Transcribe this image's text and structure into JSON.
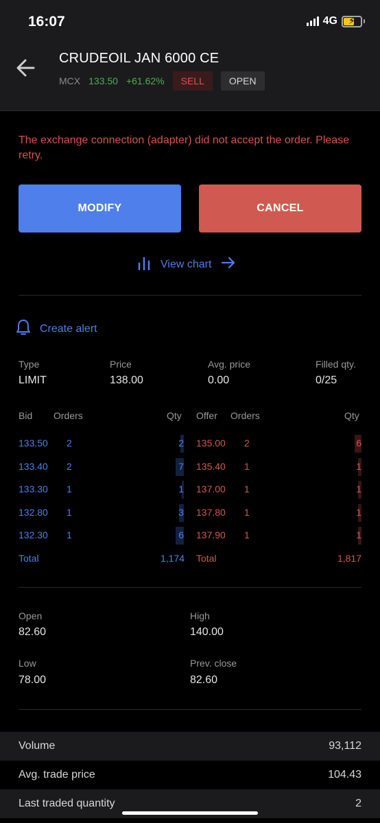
{
  "status_bar": {
    "time": "16:07",
    "network": "4G"
  },
  "header": {
    "title": "CRUDEOIL JAN 6000 CE",
    "exchange": "MCX",
    "ltp": "133.50",
    "change": "+61.62%",
    "side_badge": "SELL",
    "status_badge": "OPEN"
  },
  "error": {
    "message": "The exchange connection (adapter) did not accept the order. Please retry."
  },
  "actions": {
    "modify_label": "MODIFY",
    "cancel_label": "CANCEL",
    "view_chart_label": "View chart",
    "create_alert_label": "Create alert"
  },
  "order_info": {
    "type_label": "Type",
    "type_value": "LIMIT",
    "price_label": "Price",
    "price_value": "138.00",
    "avg_price_label": "Avg. price",
    "avg_price_value": "0.00",
    "filled_label": "Filled qty.",
    "filled_value": "0/25"
  },
  "depth": {
    "headers": {
      "bid": "Bid",
      "orders": "Orders",
      "qty": "Qty",
      "offer": "Offer"
    },
    "bids": [
      {
        "price": "133.50",
        "orders": "2",
        "qty": "2",
        "fill": 0.02
      },
      {
        "price": "133.40",
        "orders": "2",
        "qty": "7",
        "fill": 0.05
      },
      {
        "price": "133.30",
        "orders": "1",
        "qty": "1",
        "fill": 0.01
      },
      {
        "price": "132.80",
        "orders": "1",
        "qty": "3",
        "fill": 0.03
      },
      {
        "price": "132.30",
        "orders": "1",
        "qty": "6",
        "fill": 0.05
      }
    ],
    "asks": [
      {
        "price": "135.00",
        "orders": "2",
        "qty": "6",
        "fill": 0.04
      },
      {
        "price": "135.40",
        "orders": "1",
        "qty": "1",
        "fill": 0.02
      },
      {
        "price": "137.00",
        "orders": "1",
        "qty": "1",
        "fill": 0.02
      },
      {
        "price": "137.80",
        "orders": "1",
        "qty": "1",
        "fill": 0.02
      },
      {
        "price": "137.90",
        "orders": "1",
        "qty": "1",
        "fill": 0.02
      }
    ],
    "total_label": "Total",
    "bid_total": "1,174",
    "ask_total": "1,817"
  },
  "ohlc": {
    "open_label": "Open",
    "open_value": "82.60",
    "high_label": "High",
    "high_value": "140.00",
    "low_label": "Low",
    "low_value": "78.00",
    "prev_close_label": "Prev. close",
    "prev_close_value": "82.60"
  },
  "stats": [
    {
      "label": "Volume",
      "value": "93,112"
    },
    {
      "label": "Avg. trade price",
      "value": "104.43"
    },
    {
      "label": "Last traded quantity",
      "value": "2"
    }
  ],
  "colors": {
    "buy": "#4f7fea",
    "sell": "#d05a52",
    "positive": "#4caf50"
  }
}
